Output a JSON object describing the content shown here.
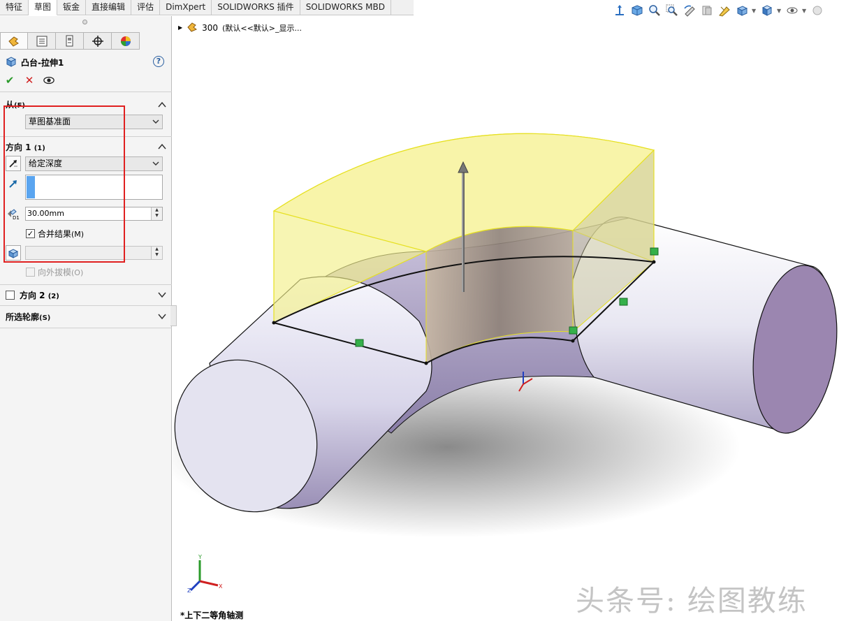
{
  "command_tabs": [
    {
      "label": "特征",
      "active": false
    },
    {
      "label": "草图",
      "active": true
    },
    {
      "label": "钣金",
      "active": false
    },
    {
      "label": "直接编辑",
      "active": false
    },
    {
      "label": "评估",
      "active": false
    },
    {
      "label": "DimXpert",
      "active": false
    },
    {
      "label": "SOLIDWORKS 插件",
      "active": false
    },
    {
      "label": "SOLIDWORKS MBD",
      "active": false
    }
  ],
  "view_toolbar_icons": [
    "view-orientation-icon",
    "standard-views-icon",
    "zoom-to-fit-icon",
    "zoom-area-icon",
    "previous-view-icon",
    "section-view-icon",
    "dynamic-annotation-icon",
    "view-orientation-cube-icon",
    "display-style-icon",
    "hide-show-icon",
    "appearance-icon"
  ],
  "panel": {
    "tab_icons": [
      "feature-manager-icon",
      "property-manager-icon",
      "configuration-manager-icon",
      "dimxpert-manager-icon",
      "display-manager-icon"
    ],
    "title": "凸台-拉伸1",
    "help": "?",
    "from": {
      "label": "从",
      "shortcut": "(F)",
      "value": "草图基准面"
    },
    "direction1": {
      "label": "方向 1",
      "shortcut": "(1)",
      "end_condition": "给定深度",
      "depth": "30.00mm",
      "merge_label": "合并结果",
      "merge_shortcut": "(M)",
      "merge_checked": "✓",
      "draft_label": "向外拔模",
      "draft_shortcut": "(O)",
      "depth_icon_label": "D1"
    },
    "direction2": {
      "label": "方向 2",
      "shortcut": "(2)"
    },
    "selected_contours": {
      "label": "所选轮廓",
      "shortcut": "(S)"
    }
  },
  "tree": {
    "part_name": "300",
    "config": "(默认<<默认>_显示..."
  },
  "view_name": "*上下二等角轴测",
  "watermark": "头条号: 绘图教练",
  "colors": {
    "highlight_frame": "#e02020",
    "extrude_preview": "#f2f08a",
    "cylinder_end": "#9b86b0",
    "accept": "#2a9a2a",
    "cancel": "#d02020"
  }
}
